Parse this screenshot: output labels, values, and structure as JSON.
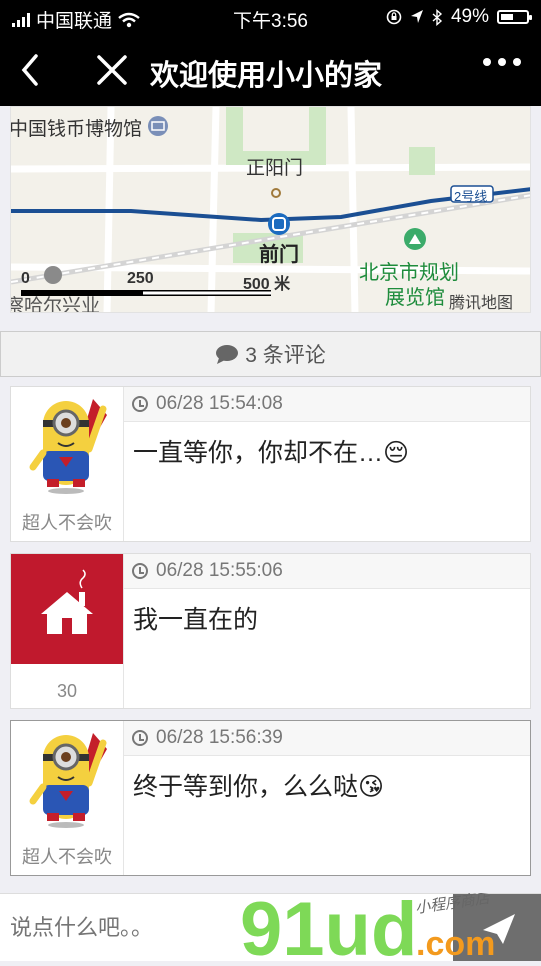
{
  "status_bar": {
    "carrier": "中国联通",
    "time": "下午3:56",
    "battery": "49%",
    "battery_level": 0.49
  },
  "navbar": {
    "title": "欢迎使用小小的家"
  },
  "map": {
    "labels": {
      "museum": "中国钱币博物馆",
      "zhengyangmen": "正阳门",
      "line2": "2号线",
      "qianmen": "前门",
      "planning_a": "北京市规划",
      "planning_b": "展览馆",
      "bottom_left": "察哈尔兴业",
      "provider": "腾讯地图",
      "scale_0": "0",
      "scale_250": "250",
      "scale_500": "500 米"
    }
  },
  "comments_header": {
    "count_label": "3 条评论"
  },
  "comments": [
    {
      "user": "超人不会吹",
      "time": "06/28 15:54:08",
      "text": "一直等你，你却不在…😔"
    },
    {
      "user": "30",
      "time": "06/28 15:55:06",
      "text": "我一直在的"
    },
    {
      "user": "超人不会吹",
      "time": "06/28 15:56:39",
      "text": "终于等到你，么么哒😘"
    }
  ],
  "input": {
    "placeholder": "说点什么吧。。"
  },
  "watermark": {
    "brand": "91ud",
    "suffix": ".com",
    "tagline": "小程序商店"
  },
  "colors": {
    "navbar_bg": "#000000",
    "home_tile": "#c0192d",
    "subway_line": "#1b4f93",
    "park_green": "#cfe8c4",
    "watermark_green": "#7ed957",
    "watermark_orange": "#f39a1e"
  },
  "icons": {
    "back": "chevron-left-icon",
    "close": "close-icon",
    "more": "more-icon",
    "comment": "speech-bubble-icon",
    "clock": "clock-icon",
    "send": "send-icon",
    "home": "home-icon"
  }
}
